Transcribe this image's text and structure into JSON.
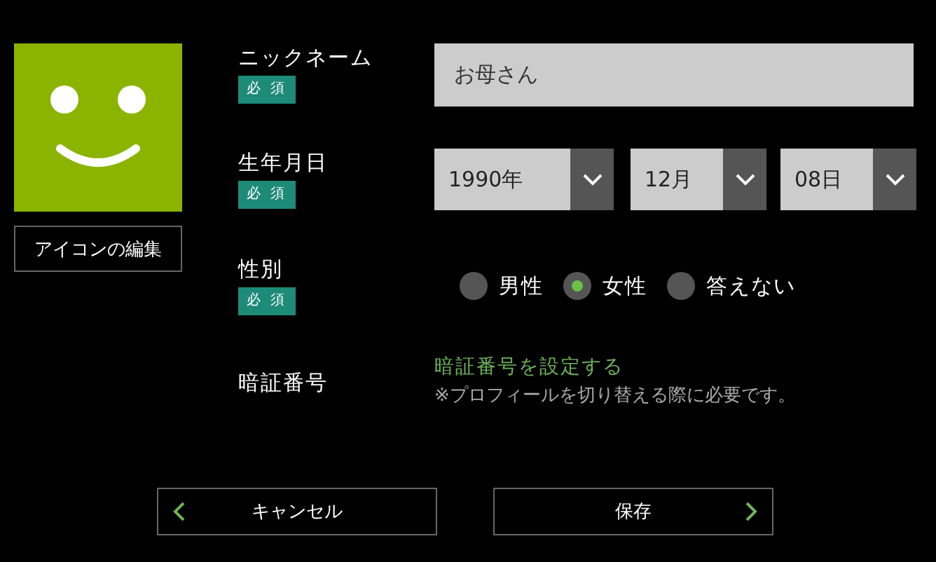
{
  "avatar": {
    "button": "アイコンの編集"
  },
  "fields": [
    {
      "kind": "text",
      "label": "ニックネーム",
      "required_badge": "必 須",
      "value": "お母さん"
    },
    {
      "kind": "date",
      "label": "生年月日",
      "required_badge": "必 須",
      "selects": [
        "1990年",
        "12月",
        "08日"
      ]
    },
    {
      "kind": "radio",
      "label": "性別",
      "required_badge": "必 須",
      "options": [
        {
          "label": "男性",
          "selected": false
        },
        {
          "label": "女性",
          "selected": true
        },
        {
          "label": "答えない",
          "selected": false
        }
      ]
    },
    {
      "kind": "link",
      "label": "暗証番号",
      "link": "暗証番号を設定する",
      "note": "※プロフィールを切り替える際に必要です。"
    }
  ],
  "buttons": [
    {
      "kind": "back",
      "label": "キャンセル"
    },
    {
      "kind": "forward",
      "label": "保存"
    }
  ]
}
